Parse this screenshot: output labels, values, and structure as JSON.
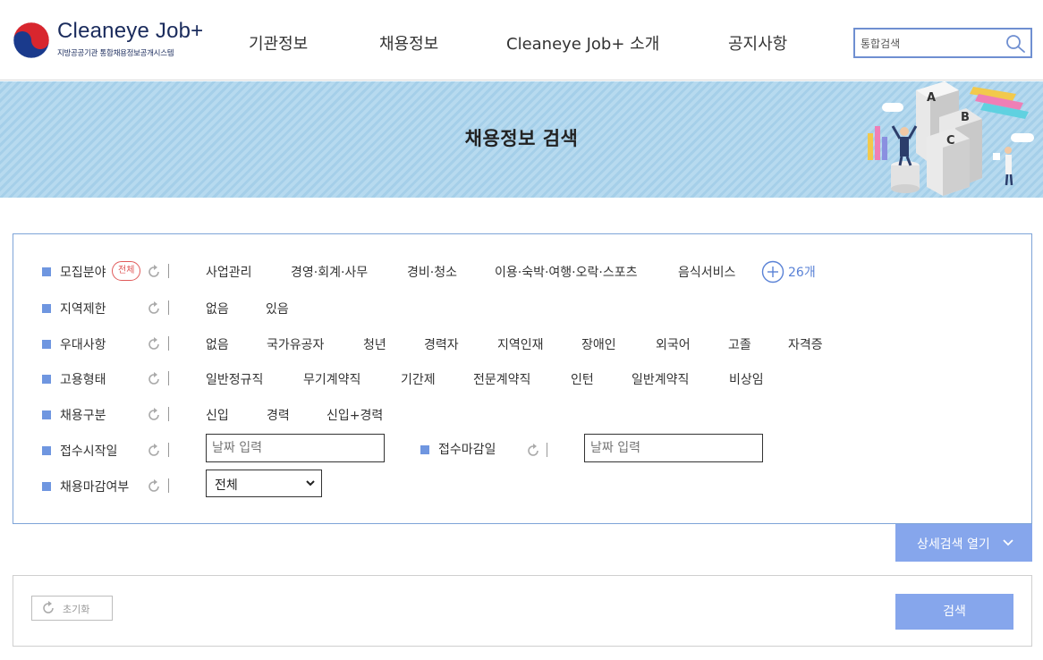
{
  "header": {
    "logo_name": "Cleaneye Job+",
    "logo_sub": "지방공공기관 통합채용정보공개시스템",
    "nav": [
      "기관정보",
      "채용정보",
      "Cleaneye Job+ 소개",
      "공지사항"
    ],
    "search_value": "통합검색"
  },
  "banner": {
    "title": "채용정보 검색",
    "illustration_letters": [
      "A",
      "B",
      "C"
    ]
  },
  "filters": {
    "field": {
      "label": "모집분야",
      "badge": "전체",
      "options": [
        "사업관리",
        "경영·회계·사무",
        "경비·청소",
        "이용·숙박·여행·오락·스포츠",
        "음식서비스"
      ],
      "more_count": "26개"
    },
    "region": {
      "label": "지역제한",
      "options": [
        "없음",
        "있음"
      ]
    },
    "preference": {
      "label": "우대사항",
      "options": [
        "없음",
        "국가유공자",
        "청년",
        "경력자",
        "지역인재",
        "장애인",
        "외국어",
        "고졸",
        "자격증"
      ]
    },
    "employment_type": {
      "label": "고용형태",
      "options": [
        "일반정규직",
        "무기계약직",
        "기간제",
        "전문계약직",
        "인턴",
        "일반계약직",
        "비상임"
      ]
    },
    "hire_type": {
      "label": "채용구분",
      "options": [
        "신입",
        "경력",
        "신입+경력"
      ]
    },
    "start_date": {
      "label": "접수시작일",
      "placeholder": "날짜 입력"
    },
    "end_date": {
      "label": "접수마감일",
      "placeholder": "날짜 입력"
    },
    "closed": {
      "label": "채용마감여부",
      "selected": "전체"
    }
  },
  "buttons": {
    "detail_search": "상세검색 열기",
    "reset": "초기화",
    "search": "검색"
  },
  "colors": {
    "brand_navy": "#1a2b5c",
    "accent_blue": "#6f96e0",
    "button_blue": "#86a6ec",
    "badge_red": "#e05a5a",
    "banner_blue": "#a5cfe9"
  }
}
